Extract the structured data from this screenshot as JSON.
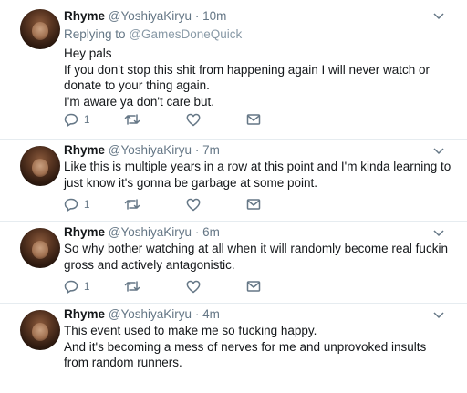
{
  "tweets": [
    {
      "name": "Rhyme",
      "handle": "@YoshiyaKiryu",
      "dot": "·",
      "time": "10m",
      "replying_prefix": "Replying to",
      "replying_to": "@GamesDoneQuick",
      "lines": [
        "Hey pals",
        "If you don't stop this shit from happening again I will never watch or donate to your thing again.",
        "I'm aware ya don't care but."
      ],
      "reply_count": "1"
    },
    {
      "name": "Rhyme",
      "handle": "@YoshiyaKiryu",
      "dot": "·",
      "time": "7m",
      "lines": [
        "Like this is multiple years in a row at this point and I'm kinda learning to just know it's gonna be garbage at some point."
      ],
      "reply_count": "1"
    },
    {
      "name": "Rhyme",
      "handle": "@YoshiyaKiryu",
      "dot": "·",
      "time": "6m",
      "lines": [
        "So why bother watching at all when it will randomly become real fuckin gross and actively antagonistic."
      ],
      "reply_count": "1"
    },
    {
      "name": "Rhyme",
      "handle": "@YoshiyaKiryu",
      "dot": "·",
      "time": "4m",
      "lines": [
        "This event used to make me so fucking happy.",
        "And it's becoming a mess of nerves for me and unprovoked insults from random runners."
      ],
      "reply_count": ""
    }
  ],
  "icons": {
    "reply": "reply-icon",
    "retweet": "retweet-icon",
    "like": "heart-icon",
    "dm": "envelope-icon",
    "menu": "chevron-down-icon"
  },
  "colors": {
    "secondary": "#657786",
    "link": "#8899a6",
    "divider": "#e6ecf0"
  }
}
